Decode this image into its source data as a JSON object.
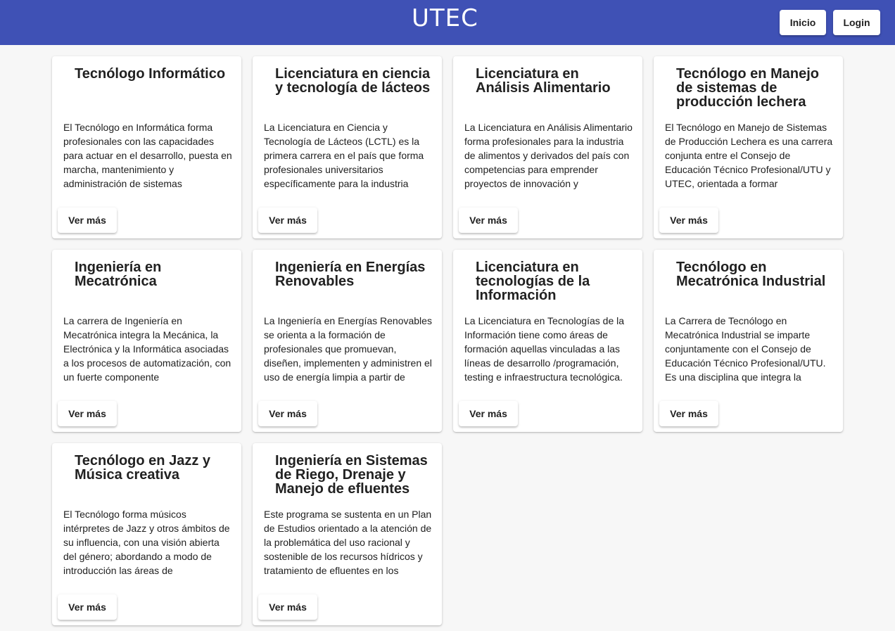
{
  "header": {
    "logo": "UTEC",
    "nav": {
      "inicio": "Inicio",
      "login": "Login"
    }
  },
  "cards": [
    {
      "title": "Tecnólogo Informático",
      "description": "El Tecnólogo en Informática forma profesionales con las capacidades para actuar en el desarrollo, puesta en marcha, mantenimiento y administración de sistemas",
      "button": "Ver más"
    },
    {
      "title": "Licenciatura en ciencia y tecnología de lácteos",
      "description": "La Licenciatura en Ciencia y Tecnología de Lácteos (LCTL) es la primera carrera en el país que forma profesionales universitarios específicamente para la industria",
      "button": "Ver más"
    },
    {
      "title": "Licenciatura en Análisis Alimentario",
      "description": "La Licenciatura en Análisis Alimentario forma profesionales para la industria de alimentos y derivados del país con competencias para emprender proyectos de innovación y",
      "button": "Ver más"
    },
    {
      "title": "Tecnólogo en Manejo de sistemas de producción lechera",
      "description": "El Tecnólogo en Manejo de Sistemas de Producción Lechera es una carrera conjunta entre el Consejo de Educación Técnico Profesional/UTU y UTEC, orientada a formar",
      "button": "Ver más"
    },
    {
      "title": "Ingeniería en Mecatrónica",
      "description": "La carrera de Ingeniería en Mecatrónica integra la Mecánica, la Electrónica y la Informática asociadas a los procesos de automatización, con un fuerte componente",
      "button": "Ver más"
    },
    {
      "title": "Ingeniería en Energías Renovables",
      "description": "La Ingeniería en Energías Renovables se orienta a la formación de profesionales que promuevan, diseñen, implementen y administren el uso de energía limpia a partir de",
      "button": "Ver más"
    },
    {
      "title": "Licenciatura en tecnologías de la Información",
      "description": "La Licenciatura en Tecnologías de la Información tiene como áreas de formación aquellas vinculadas a las líneas de desarrollo /programación, testing e infraestructura tecnológica.",
      "button": "Ver más"
    },
    {
      "title": "Tecnólogo en Mecatrónica Industrial",
      "description": "La Carrera de Tecnólogo en Mecatrónica Industrial se imparte conjuntamente con el Consejo de Educación Técnico Profesional/UTU. Es una disciplina que integra la",
      "button": "Ver más"
    },
    {
      "title": "Tecnólogo en Jazz y Música creativa",
      "description": "El Tecnólogo forma músicos intérpretes de Jazz y otros ámbitos de su influencia, con una visión abierta del género; abordando a modo de introducción las áreas de",
      "button": "Ver más"
    },
    {
      "title": "Ingeniería en Sistemas de Riego, Drenaje y Manejo de efluentes",
      "description": "Este programa se sustenta en un Plan de Estudios orientado a la atención de la problemática del uso racional y sostenible de los recursos hídricos y tratamiento de efluentes en los",
      "button": "Ver más"
    }
  ],
  "colors": {
    "header_bg": "#3f51b5",
    "page_bg": "#f7f7f7",
    "card_bg": "#ffffff",
    "text": "#212121"
  }
}
